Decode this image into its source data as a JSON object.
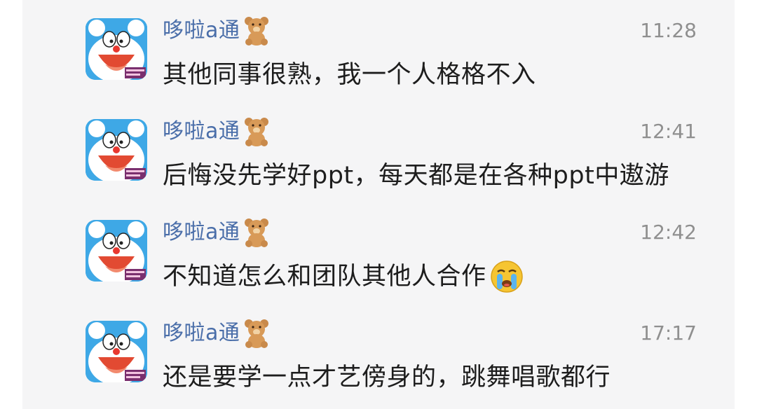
{
  "messages": [
    {
      "sender": "哆啦a通",
      "badge_icon": "teddy-bear-icon",
      "time": "11:28",
      "text": "其他同事很熟，我一个人格格不入",
      "emoji": ""
    },
    {
      "sender": "哆啦a通",
      "badge_icon": "teddy-bear-icon",
      "time": "12:41",
      "text": "后悔没先学好ppt，每天都是在各种ppt中遨游",
      "emoji": ""
    },
    {
      "sender": "哆啦a通",
      "badge_icon": "teddy-bear-icon",
      "time": "12:42",
      "text": "不知道怎么和团队其他人合作",
      "emoji": "crying-face-icon"
    },
    {
      "sender": "哆啦a通",
      "badge_icon": "teddy-bear-icon",
      "time": "17:17",
      "text": "还是要学一点才艺傍身的，跳舞唱歌都行",
      "emoji": ""
    }
  ],
  "colors": {
    "background": "#f5f5f6",
    "sender_name": "#4a6ea9",
    "timestamp": "#8f8f8f",
    "message_text": "#1d1d1d",
    "avatar_blue": "#3ea8e6"
  }
}
